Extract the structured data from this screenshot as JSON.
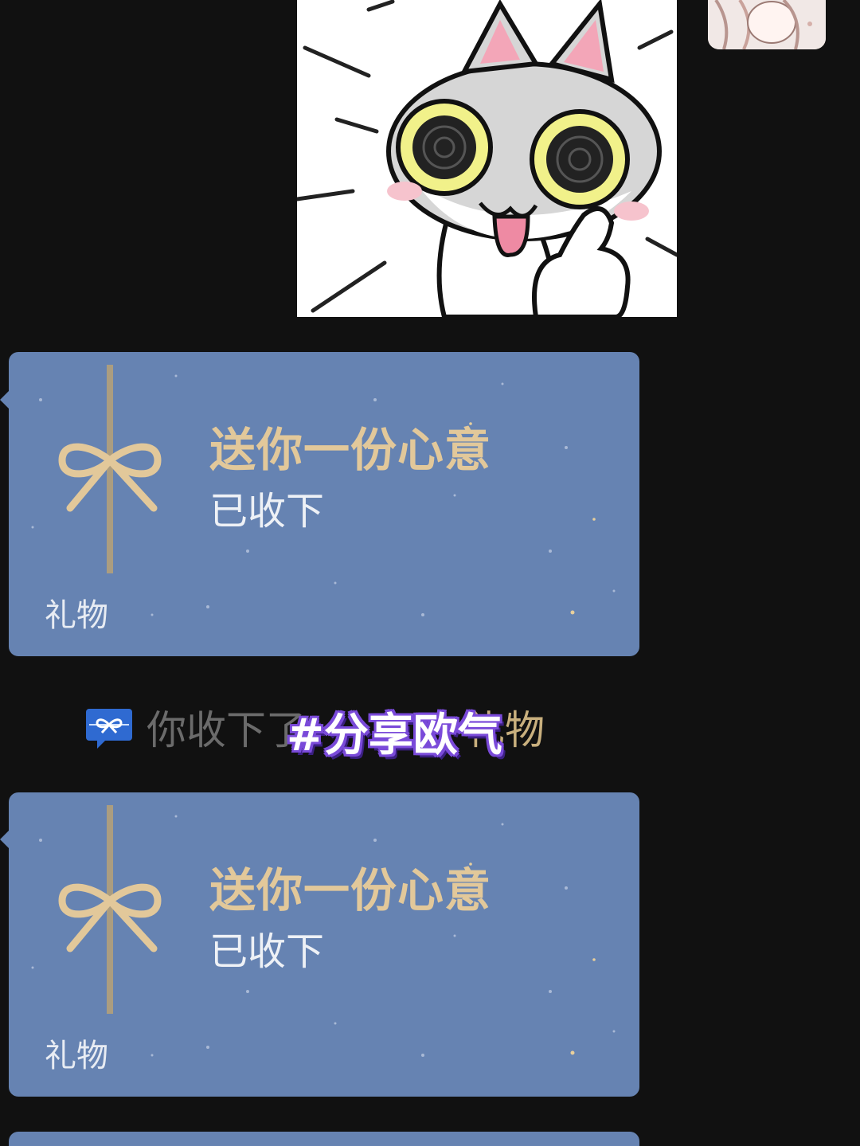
{
  "colors": {
    "background": "#111111",
    "gift_card": "#6683b2",
    "gift_gold": "#e2c89a",
    "notice_gray": "#6b6b6b",
    "notice_link": "#c9b07e",
    "hashtag_outline": "#7a4ad9"
  },
  "messages": [
    {
      "kind": "sticker",
      "side": "right",
      "icon": "cat-thumbs-up-sticker"
    },
    {
      "kind": "gift",
      "side": "left",
      "title": "送你一份心意",
      "status": "已收下",
      "label": "礼物",
      "icon": "gift-bow-icon"
    },
    {
      "kind": "gift",
      "side": "left",
      "title": "送你一份心意",
      "status": "已收下",
      "label": "礼物",
      "icon": "gift-bow-icon"
    }
  ],
  "notice": {
    "icon": "gift-chat-icon",
    "text": "你收下了",
    "link": "礼物"
  },
  "overlay": {
    "hashtag": "#分享欧气"
  }
}
